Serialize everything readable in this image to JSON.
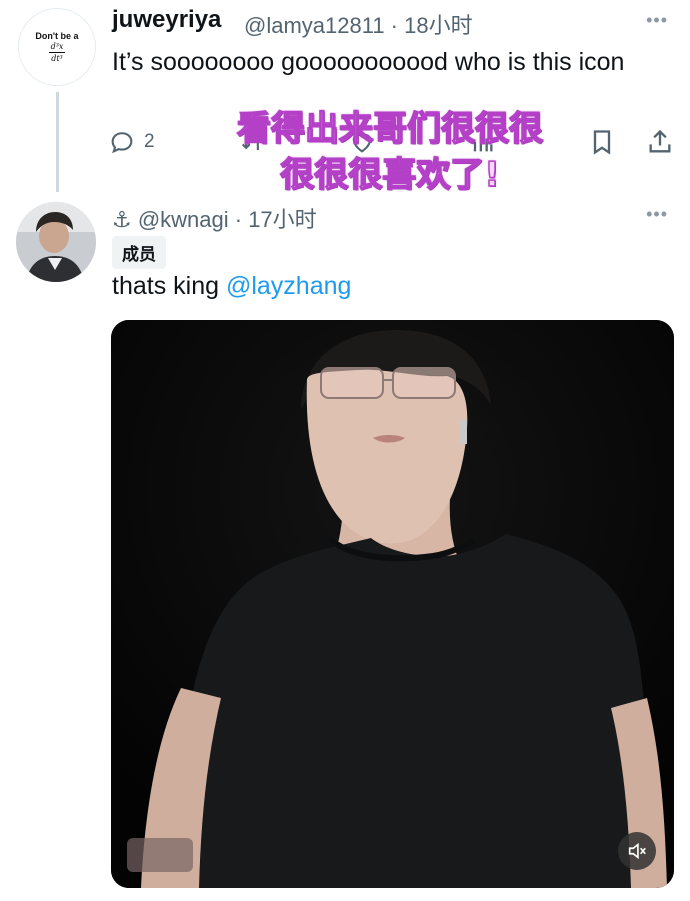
{
  "reply1": {
    "avatar_text": "Don't be a",
    "avatar_numerator": "d³x",
    "avatar_denominator": "dt³",
    "display_name": "juweyriya",
    "handle_time": "@lamya12811 · 18小时",
    "text": "It’s soooooooo gooooooooood who is this icon",
    "reply_count": "2",
    "more": "•••"
  },
  "overlay_caption": {
    "line1": "看得出来哥们很很很",
    "line2": "很很很喜欢了!"
  },
  "reply2": {
    "handle_time": "⚓ @kwnagi · 17小时",
    "badge": "成员",
    "text_prefix": "thats king ",
    "mention": "@layzhang",
    "more": "•••"
  },
  "colors": {
    "accent": "#1d9bf0",
    "secondary_text": "#536471",
    "overlay_fill": "#f3d9f7",
    "overlay_stroke": "#b540c8"
  },
  "icons": {
    "reply": "reply-icon",
    "retweet": "retweet-icon",
    "like": "heart-icon",
    "views": "views-icon",
    "bookmark": "bookmark-icon",
    "share": "share-icon",
    "mute": "mute-icon"
  }
}
